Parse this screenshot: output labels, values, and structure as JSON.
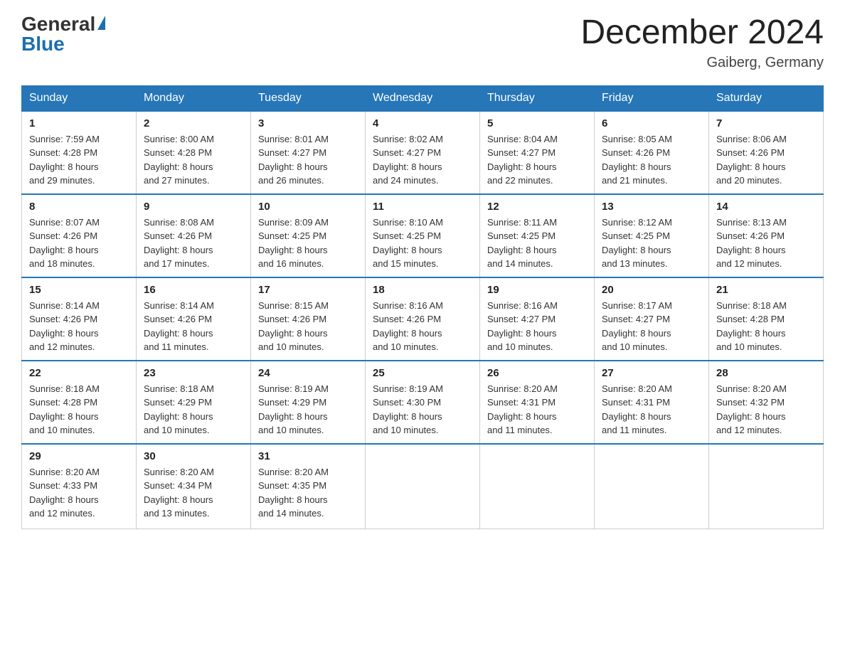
{
  "logo": {
    "general": "General",
    "blue": "Blue",
    "triangle": "▶"
  },
  "title": "December 2024",
  "location": "Gaiberg, Germany",
  "weekdays": [
    "Sunday",
    "Monday",
    "Tuesday",
    "Wednesday",
    "Thursday",
    "Friday",
    "Saturday"
  ],
  "weeks": [
    [
      {
        "day": "1",
        "sunrise": "7:59 AM",
        "sunset": "4:28 PM",
        "daylight": "8 hours and 29 minutes."
      },
      {
        "day": "2",
        "sunrise": "8:00 AM",
        "sunset": "4:28 PM",
        "daylight": "8 hours and 27 minutes."
      },
      {
        "day": "3",
        "sunrise": "8:01 AM",
        "sunset": "4:27 PM",
        "daylight": "8 hours and 26 minutes."
      },
      {
        "day": "4",
        "sunrise": "8:02 AM",
        "sunset": "4:27 PM",
        "daylight": "8 hours and 24 minutes."
      },
      {
        "day": "5",
        "sunrise": "8:04 AM",
        "sunset": "4:27 PM",
        "daylight": "8 hours and 22 minutes."
      },
      {
        "day": "6",
        "sunrise": "8:05 AM",
        "sunset": "4:26 PM",
        "daylight": "8 hours and 21 minutes."
      },
      {
        "day": "7",
        "sunrise": "8:06 AM",
        "sunset": "4:26 PM",
        "daylight": "8 hours and 20 minutes."
      }
    ],
    [
      {
        "day": "8",
        "sunrise": "8:07 AM",
        "sunset": "4:26 PM",
        "daylight": "8 hours and 18 minutes."
      },
      {
        "day": "9",
        "sunrise": "8:08 AM",
        "sunset": "4:26 PM",
        "daylight": "8 hours and 17 minutes."
      },
      {
        "day": "10",
        "sunrise": "8:09 AM",
        "sunset": "4:25 PM",
        "daylight": "8 hours and 16 minutes."
      },
      {
        "day": "11",
        "sunrise": "8:10 AM",
        "sunset": "4:25 PM",
        "daylight": "8 hours and 15 minutes."
      },
      {
        "day": "12",
        "sunrise": "8:11 AM",
        "sunset": "4:25 PM",
        "daylight": "8 hours and 14 minutes."
      },
      {
        "day": "13",
        "sunrise": "8:12 AM",
        "sunset": "4:25 PM",
        "daylight": "8 hours and 13 minutes."
      },
      {
        "day": "14",
        "sunrise": "8:13 AM",
        "sunset": "4:26 PM",
        "daylight": "8 hours and 12 minutes."
      }
    ],
    [
      {
        "day": "15",
        "sunrise": "8:14 AM",
        "sunset": "4:26 PM",
        "daylight": "8 hours and 12 minutes."
      },
      {
        "day": "16",
        "sunrise": "8:14 AM",
        "sunset": "4:26 PM",
        "daylight": "8 hours and 11 minutes."
      },
      {
        "day": "17",
        "sunrise": "8:15 AM",
        "sunset": "4:26 PM",
        "daylight": "8 hours and 10 minutes."
      },
      {
        "day": "18",
        "sunrise": "8:16 AM",
        "sunset": "4:26 PM",
        "daylight": "8 hours and 10 minutes."
      },
      {
        "day": "19",
        "sunrise": "8:16 AM",
        "sunset": "4:27 PM",
        "daylight": "8 hours and 10 minutes."
      },
      {
        "day": "20",
        "sunrise": "8:17 AM",
        "sunset": "4:27 PM",
        "daylight": "8 hours and 10 minutes."
      },
      {
        "day": "21",
        "sunrise": "8:18 AM",
        "sunset": "4:28 PM",
        "daylight": "8 hours and 10 minutes."
      }
    ],
    [
      {
        "day": "22",
        "sunrise": "8:18 AM",
        "sunset": "4:28 PM",
        "daylight": "8 hours and 10 minutes."
      },
      {
        "day": "23",
        "sunrise": "8:18 AM",
        "sunset": "4:29 PM",
        "daylight": "8 hours and 10 minutes."
      },
      {
        "day": "24",
        "sunrise": "8:19 AM",
        "sunset": "4:29 PM",
        "daylight": "8 hours and 10 minutes."
      },
      {
        "day": "25",
        "sunrise": "8:19 AM",
        "sunset": "4:30 PM",
        "daylight": "8 hours and 10 minutes."
      },
      {
        "day": "26",
        "sunrise": "8:20 AM",
        "sunset": "4:31 PM",
        "daylight": "8 hours and 11 minutes."
      },
      {
        "day": "27",
        "sunrise": "8:20 AM",
        "sunset": "4:31 PM",
        "daylight": "8 hours and 11 minutes."
      },
      {
        "day": "28",
        "sunrise": "8:20 AM",
        "sunset": "4:32 PM",
        "daylight": "8 hours and 12 minutes."
      }
    ],
    [
      {
        "day": "29",
        "sunrise": "8:20 AM",
        "sunset": "4:33 PM",
        "daylight": "8 hours and 12 minutes."
      },
      {
        "day": "30",
        "sunrise": "8:20 AM",
        "sunset": "4:34 PM",
        "daylight": "8 hours and 13 minutes."
      },
      {
        "day": "31",
        "sunrise": "8:20 AM",
        "sunset": "4:35 PM",
        "daylight": "8 hours and 14 minutes."
      },
      null,
      null,
      null,
      null
    ]
  ],
  "labels": {
    "sunrise": "Sunrise:",
    "sunset": "Sunset:",
    "daylight": "Daylight:"
  }
}
